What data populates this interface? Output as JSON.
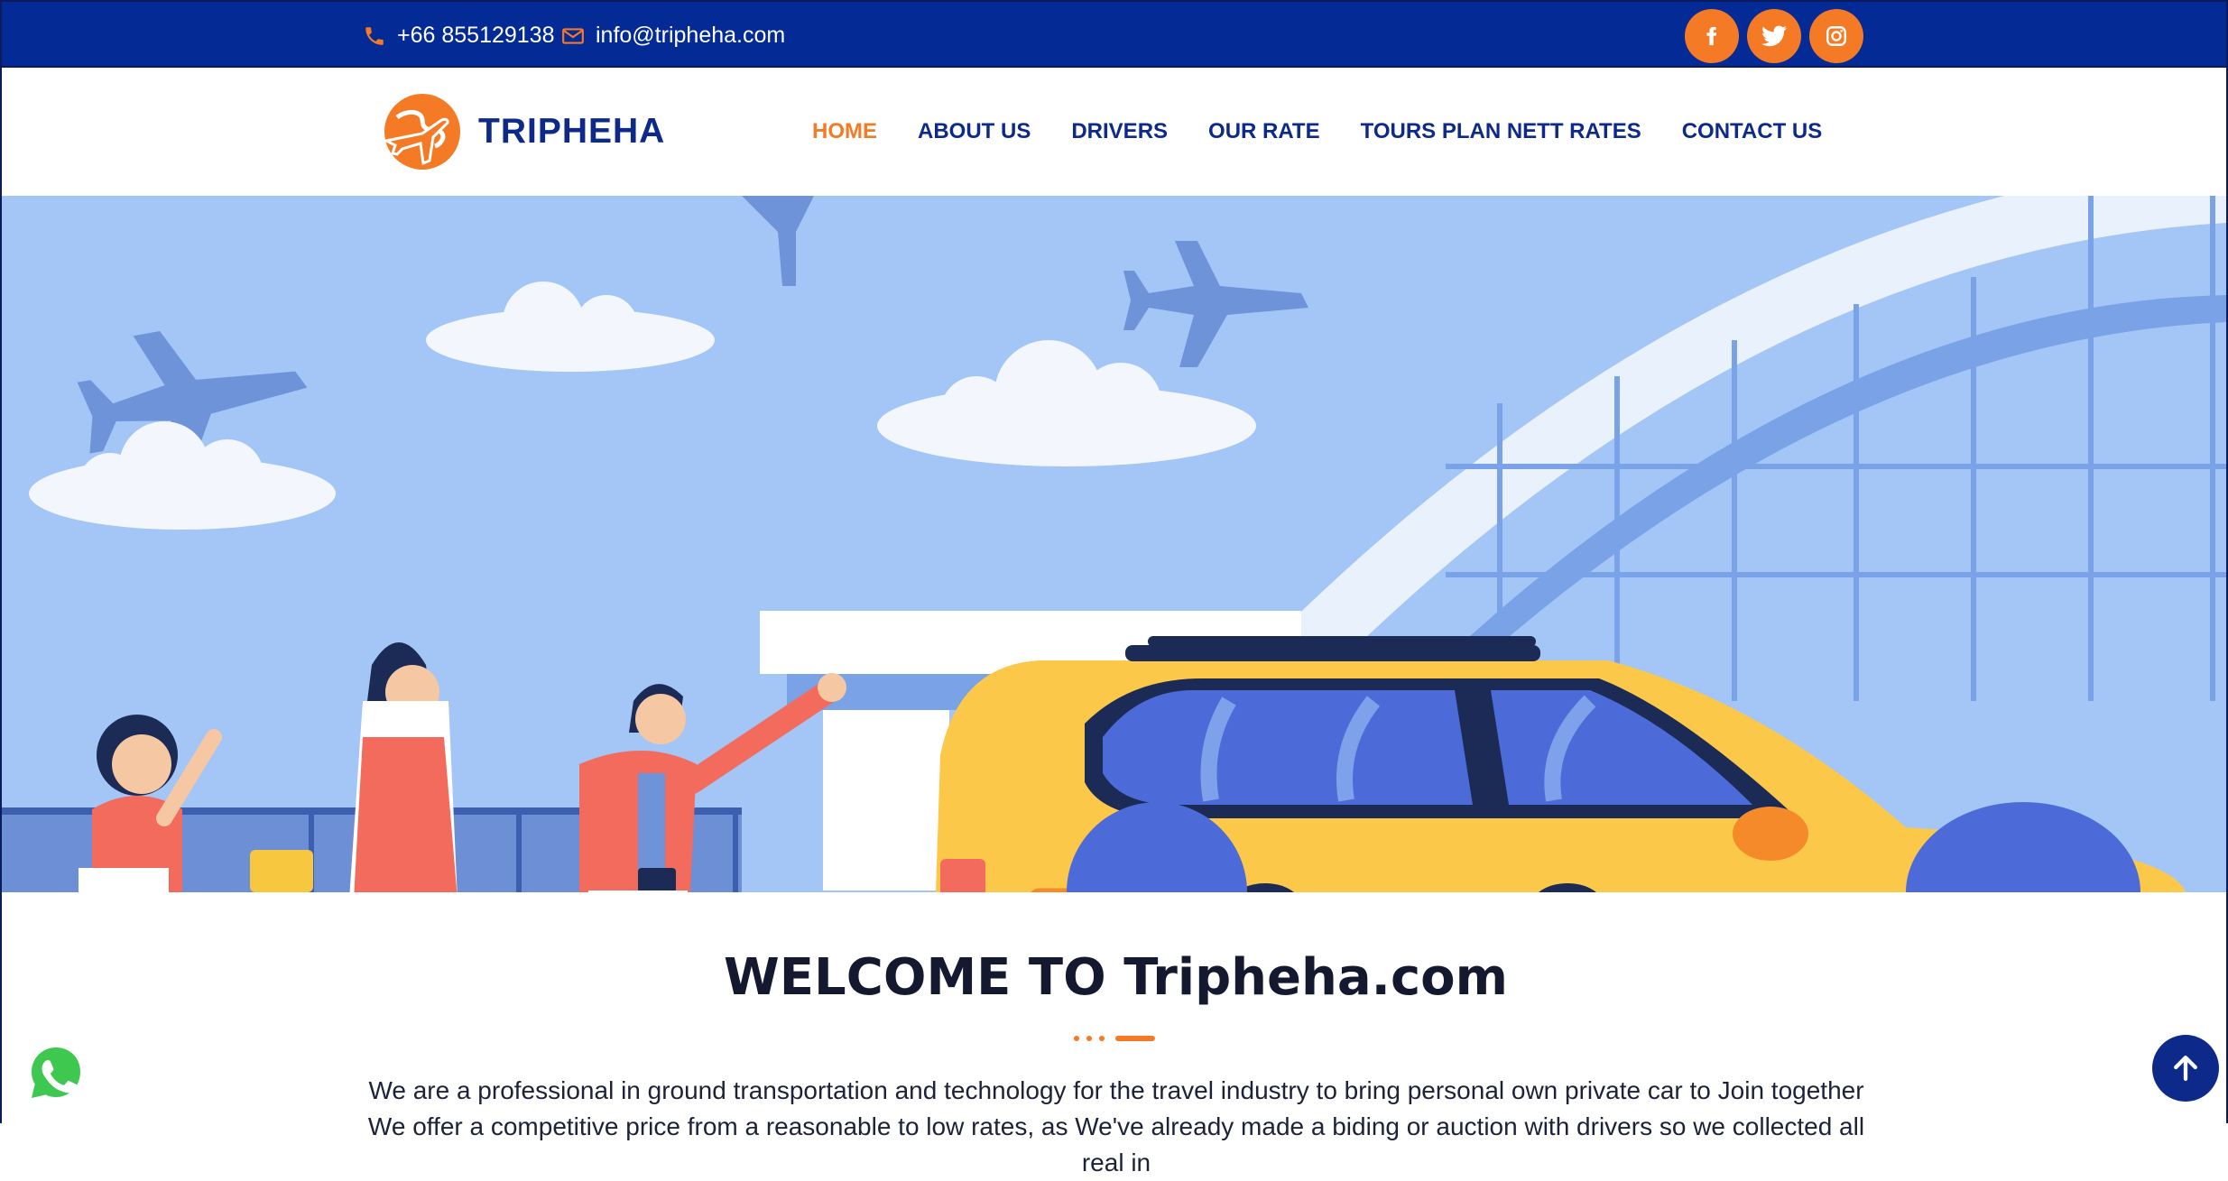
{
  "topbar": {
    "phone": "+66 855129138",
    "email": "info@tripheha.com",
    "social": [
      {
        "name": "facebook-icon"
      },
      {
        "name": "twitter-icon"
      },
      {
        "name": "instagram-icon"
      }
    ]
  },
  "header": {
    "logo_text": "TRIPHEHA",
    "nav": [
      {
        "label": "HOME",
        "active": true
      },
      {
        "label": "ABOUT US"
      },
      {
        "label": "DRIVERS"
      },
      {
        "label": "OUR RATE"
      },
      {
        "label": "TOURS PLAN NETT RATES"
      },
      {
        "label": "CONTACT US"
      }
    ]
  },
  "welcome": {
    "title": "WELCOME TO Tripheha.com",
    "text": "We are a professional in ground transportation and technology for the travel industry to bring personal own private car to Join together We offer a competitive price from a reasonable to low rates, as We've already made a biding or auction with drivers so we collected all real in"
  },
  "colors": {
    "brand_blue": "#042a96",
    "accent_orange": "#f47a26",
    "nav_blue": "#0d2a8a"
  }
}
